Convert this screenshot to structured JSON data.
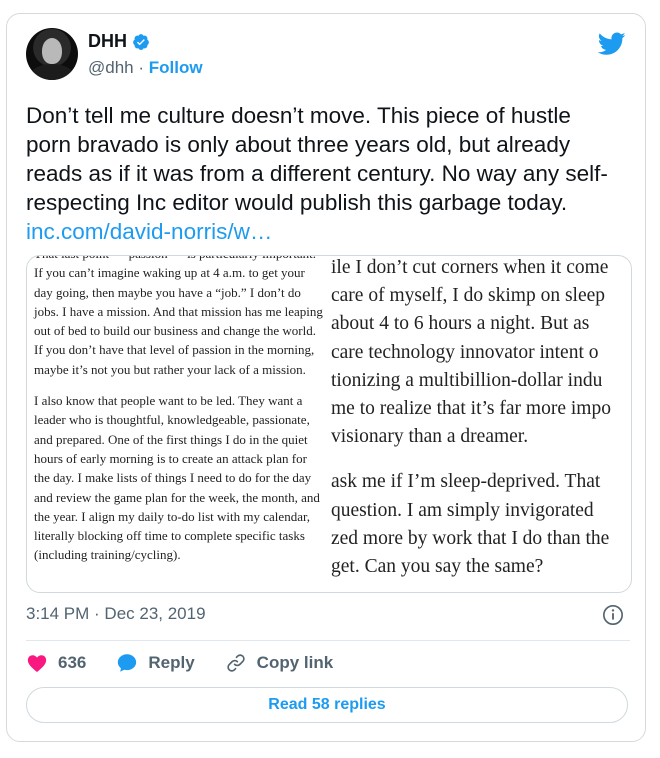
{
  "author": {
    "name": "DHH",
    "handle": "@dhh",
    "separator": "·",
    "follow_label": "Follow"
  },
  "tweet": {
    "text": "Don’t tell me culture doesn’t move. This piece of hustle porn bravado is only about three years old, but already reads as if it was from a different century. No way any self-respecting Inc editor would publish this garbage today.",
    "link": "inc.com/david-norris/w…"
  },
  "media": {
    "left_paragraphs": [
      "That last point — passion — is particularly important. If you can’t imagine waking up at 4 a.m. to get your day going, then maybe you have a “job.” I don’t do jobs. I have a mission. And that mission has me leaping out of bed to build our business and change the world. If you don’t have that level of passion in the morning, maybe it’s not you but rather your lack of a mission.",
      "I also know that people want to be led. They want a leader who is thoughtful, knowledgeable, passionate, and prepared. One of the first things I do in the quiet hours of early morning is to create an attack plan for the day. I make lists of things I need to do for the day and review the game plan for the week, the month, and the year. I align my daily to-do list with my calendar, literally blocking off time to complete specific tasks (including training/cycling)."
    ],
    "right_lines_p1": [
      "ile I don’t cut corners when it come",
      "care of myself, I do skimp on sleep",
      " about 4 to 6 hours a night. But as",
      "care technology innovator intent o",
      "tionizing a multibillion-dollar indu",
      "me to realize that it’s far more impo",
      " visionary than a dreamer."
    ],
    "right_lines_p2": [
      " ask me if I’m sleep-deprived. That",
      " question. I am simply invigorated",
      "zed more by work that I do than the",
      "get. Can you say the same?"
    ]
  },
  "meta": {
    "timestamp": "3:14 PM · Dec 23, 2019"
  },
  "actions": {
    "like_count": "636",
    "reply_label": "Reply",
    "copy_link_label": "Copy link"
  },
  "footer": {
    "read_replies_label": "Read 58 replies"
  },
  "colors": {
    "accent": "#1d9bf0",
    "like": "#f91880",
    "muted": "#536471"
  }
}
